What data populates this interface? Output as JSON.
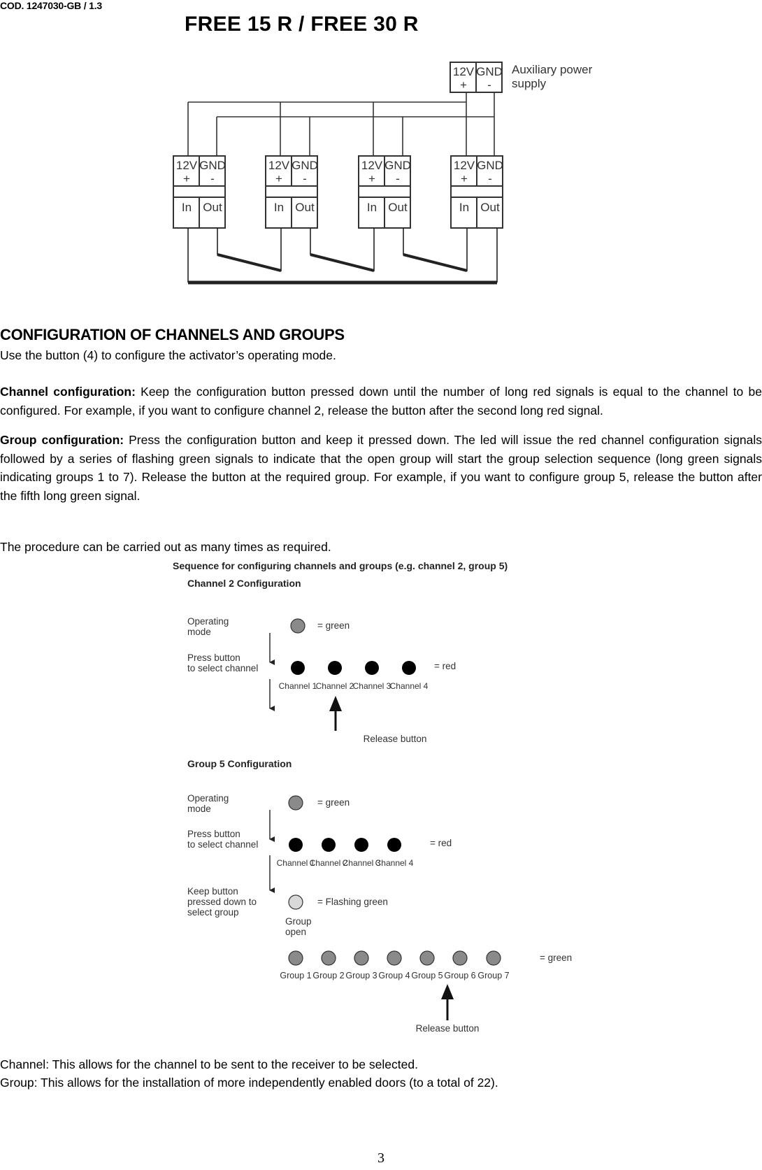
{
  "header": {
    "doc_code": "COD. 1247030-GB / 1.3",
    "title": "FREE 15 R / FREE 30 R"
  },
  "wiring_diagram": {
    "aux_supply": {
      "terminal_12v": "12V",
      "terminal_12v_sign": "+",
      "terminal_gnd": "GND",
      "terminal_gnd_sign": "-",
      "label_line1": "Auxiliary power",
      "label_line2": "supply"
    },
    "units": [
      {
        "t1": "12V",
        "t1_sign": "+",
        "t2": "GND",
        "t2_sign": "-",
        "in": "In",
        "out": "Out"
      },
      {
        "t1": "12V",
        "t1_sign": "+",
        "t2": "GND",
        "t2_sign": "-",
        "in": "In",
        "out": "Out"
      },
      {
        "t1": "12V",
        "t1_sign": "+",
        "t2": "GND",
        "t2_sign": "-",
        "in": "In",
        "out": "Out"
      },
      {
        "t1": "12V",
        "t1_sign": "+",
        "t2": "GND",
        "t2_sign": "-",
        "in": "In",
        "out": "Out"
      }
    ]
  },
  "section": {
    "heading": "CONFIGURATION OF CHANNELS AND GROUPS",
    "intro": "Use the button (4) to configure the activator’s operating mode.",
    "channel_config_label": "Channel configuration:",
    "channel_config_text": " Keep the configuration button pressed down until the number of long red signals is equal to the channel to be configured.  For example, if you want to configure channel 2, release the button after the second long red signal.",
    "group_config_label": "Group configuration:",
    "group_config_text": "  Press the configuration button and keep it pressed down.  The led will issue the red channel configuration signals followed by a series of flashing green signals to indicate that the open group will start the group selection sequence (long green signals indicating groups 1 to 7).  Release the button at the required group.  For example, if you want to configure group 5, release the button after the fifth long green signal.",
    "procedure_note": "The procedure can be carried out as many times as required."
  },
  "sequence_diagram": {
    "title": "Sequence for configuring channels and groups (e.g.  channel 2, group 5)",
    "colors": {
      "green": "#8a8a8a",
      "red": "#000000",
      "flashing_green": "#d9d9d9"
    },
    "channel_block": {
      "heading": "Channel 2 Configuration",
      "operating_mode_line1": "Operating",
      "operating_mode_line2": "mode",
      "green_legend": "= green",
      "press_line1": "Press button",
      "press_line2": "to select channel",
      "red_legend": "= red",
      "channels": [
        "Channel 1",
        "Channel 2",
        "Channel 3",
        "Channel 4"
      ],
      "release_label": "Release button",
      "release_at_channel": 2
    },
    "group_block": {
      "heading": "Group 5 Configuration",
      "operating_mode_line1": "Operating",
      "operating_mode_line2": "mode",
      "green_legend": "= green",
      "press_line1": "Press button",
      "press_line2": "to select channel",
      "red_legend": "= red",
      "channels": [
        "Channel 1",
        "Channel 2",
        "Channel 3",
        "Channel 4"
      ],
      "keep_line1": "Keep button",
      "keep_line2": "pressed down to",
      "keep_line3": "select group",
      "flashing_legend": "= Flashing green",
      "group_open_line1": "Group",
      "group_open_line2": "open",
      "groups_legend": "= green",
      "groups": [
        "Group 1",
        "Group 2",
        "Group 3",
        "Group 4",
        "Group 5",
        "Group 6",
        "Group 7"
      ],
      "release_label": "Release button",
      "release_at_group": 5
    }
  },
  "footer_notes": {
    "channel_note": "Channel: This allows for the channel to be sent to the receiver to be selected.",
    "group_note": "Group: This allows for the installation of more independently enabled doors (to a total of 22)."
  },
  "page_number": "3"
}
